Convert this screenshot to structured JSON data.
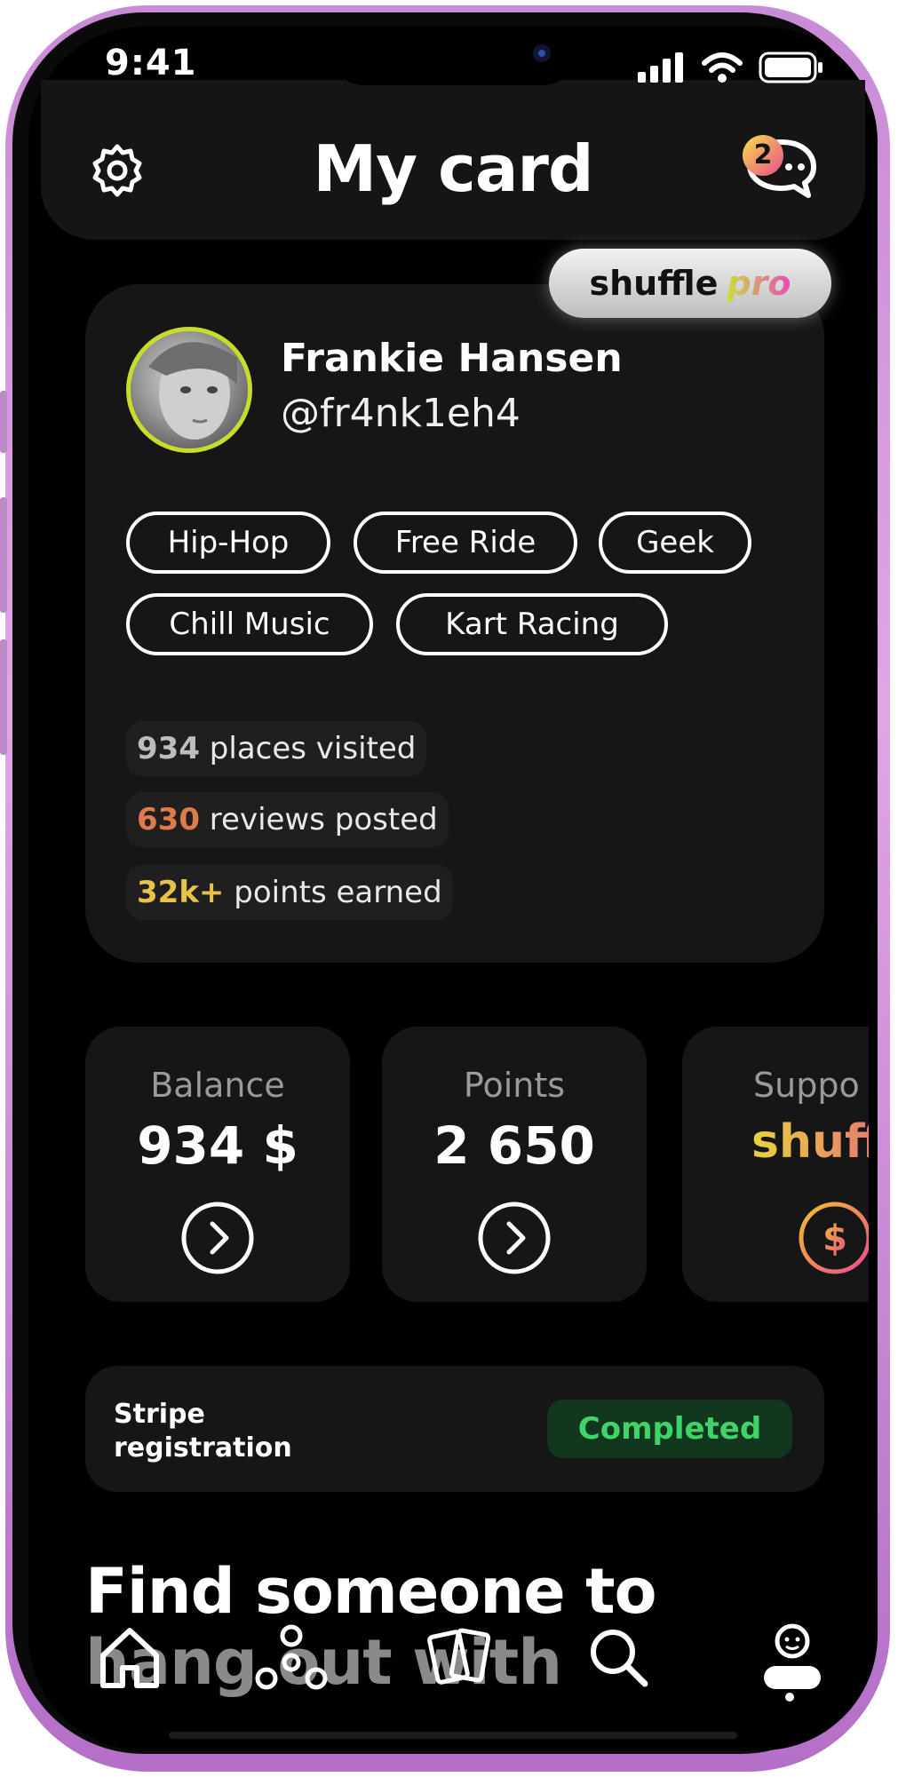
{
  "status_bar": {
    "time": "9:41"
  },
  "header": {
    "title": "My card",
    "messages_badge": "2"
  },
  "profile": {
    "badge_word": "shuffle",
    "badge_tier": "pro",
    "name": "Frankie Hansen",
    "handle": "@fr4nk1eh4",
    "tags": [
      "Hip-Hop",
      "Free Ride",
      "Geek",
      "Chill Music",
      "Kart Racing"
    ],
    "stats": [
      {
        "value": "934",
        "label": "places visited",
        "color": "#bdbdbd"
      },
      {
        "value": "630",
        "label": "reviews posted",
        "color": "#e07a4a"
      },
      {
        "value": "32k+",
        "label": "points earned",
        "color": "#e8c24a"
      }
    ]
  },
  "cards": {
    "balance": {
      "label": "Balance",
      "value": "934 $"
    },
    "points": {
      "label": "Points",
      "value": "2 650"
    },
    "support": {
      "label": "Suppo",
      "value": "shuff"
    }
  },
  "stripe": {
    "label": "Stripe registration",
    "status": "Completed"
  },
  "promo": {
    "line1": "Find someone to",
    "line2": "hang out with"
  },
  "nav": {
    "items": [
      "home-icon",
      "fidget-icon",
      "cards-icon",
      "search-icon",
      "profile-icon"
    ],
    "active": "profile-icon"
  },
  "colors": {
    "accent_lime": "#c8dc2a",
    "success_green": "#3ed46a",
    "card_bg": "#161616"
  }
}
